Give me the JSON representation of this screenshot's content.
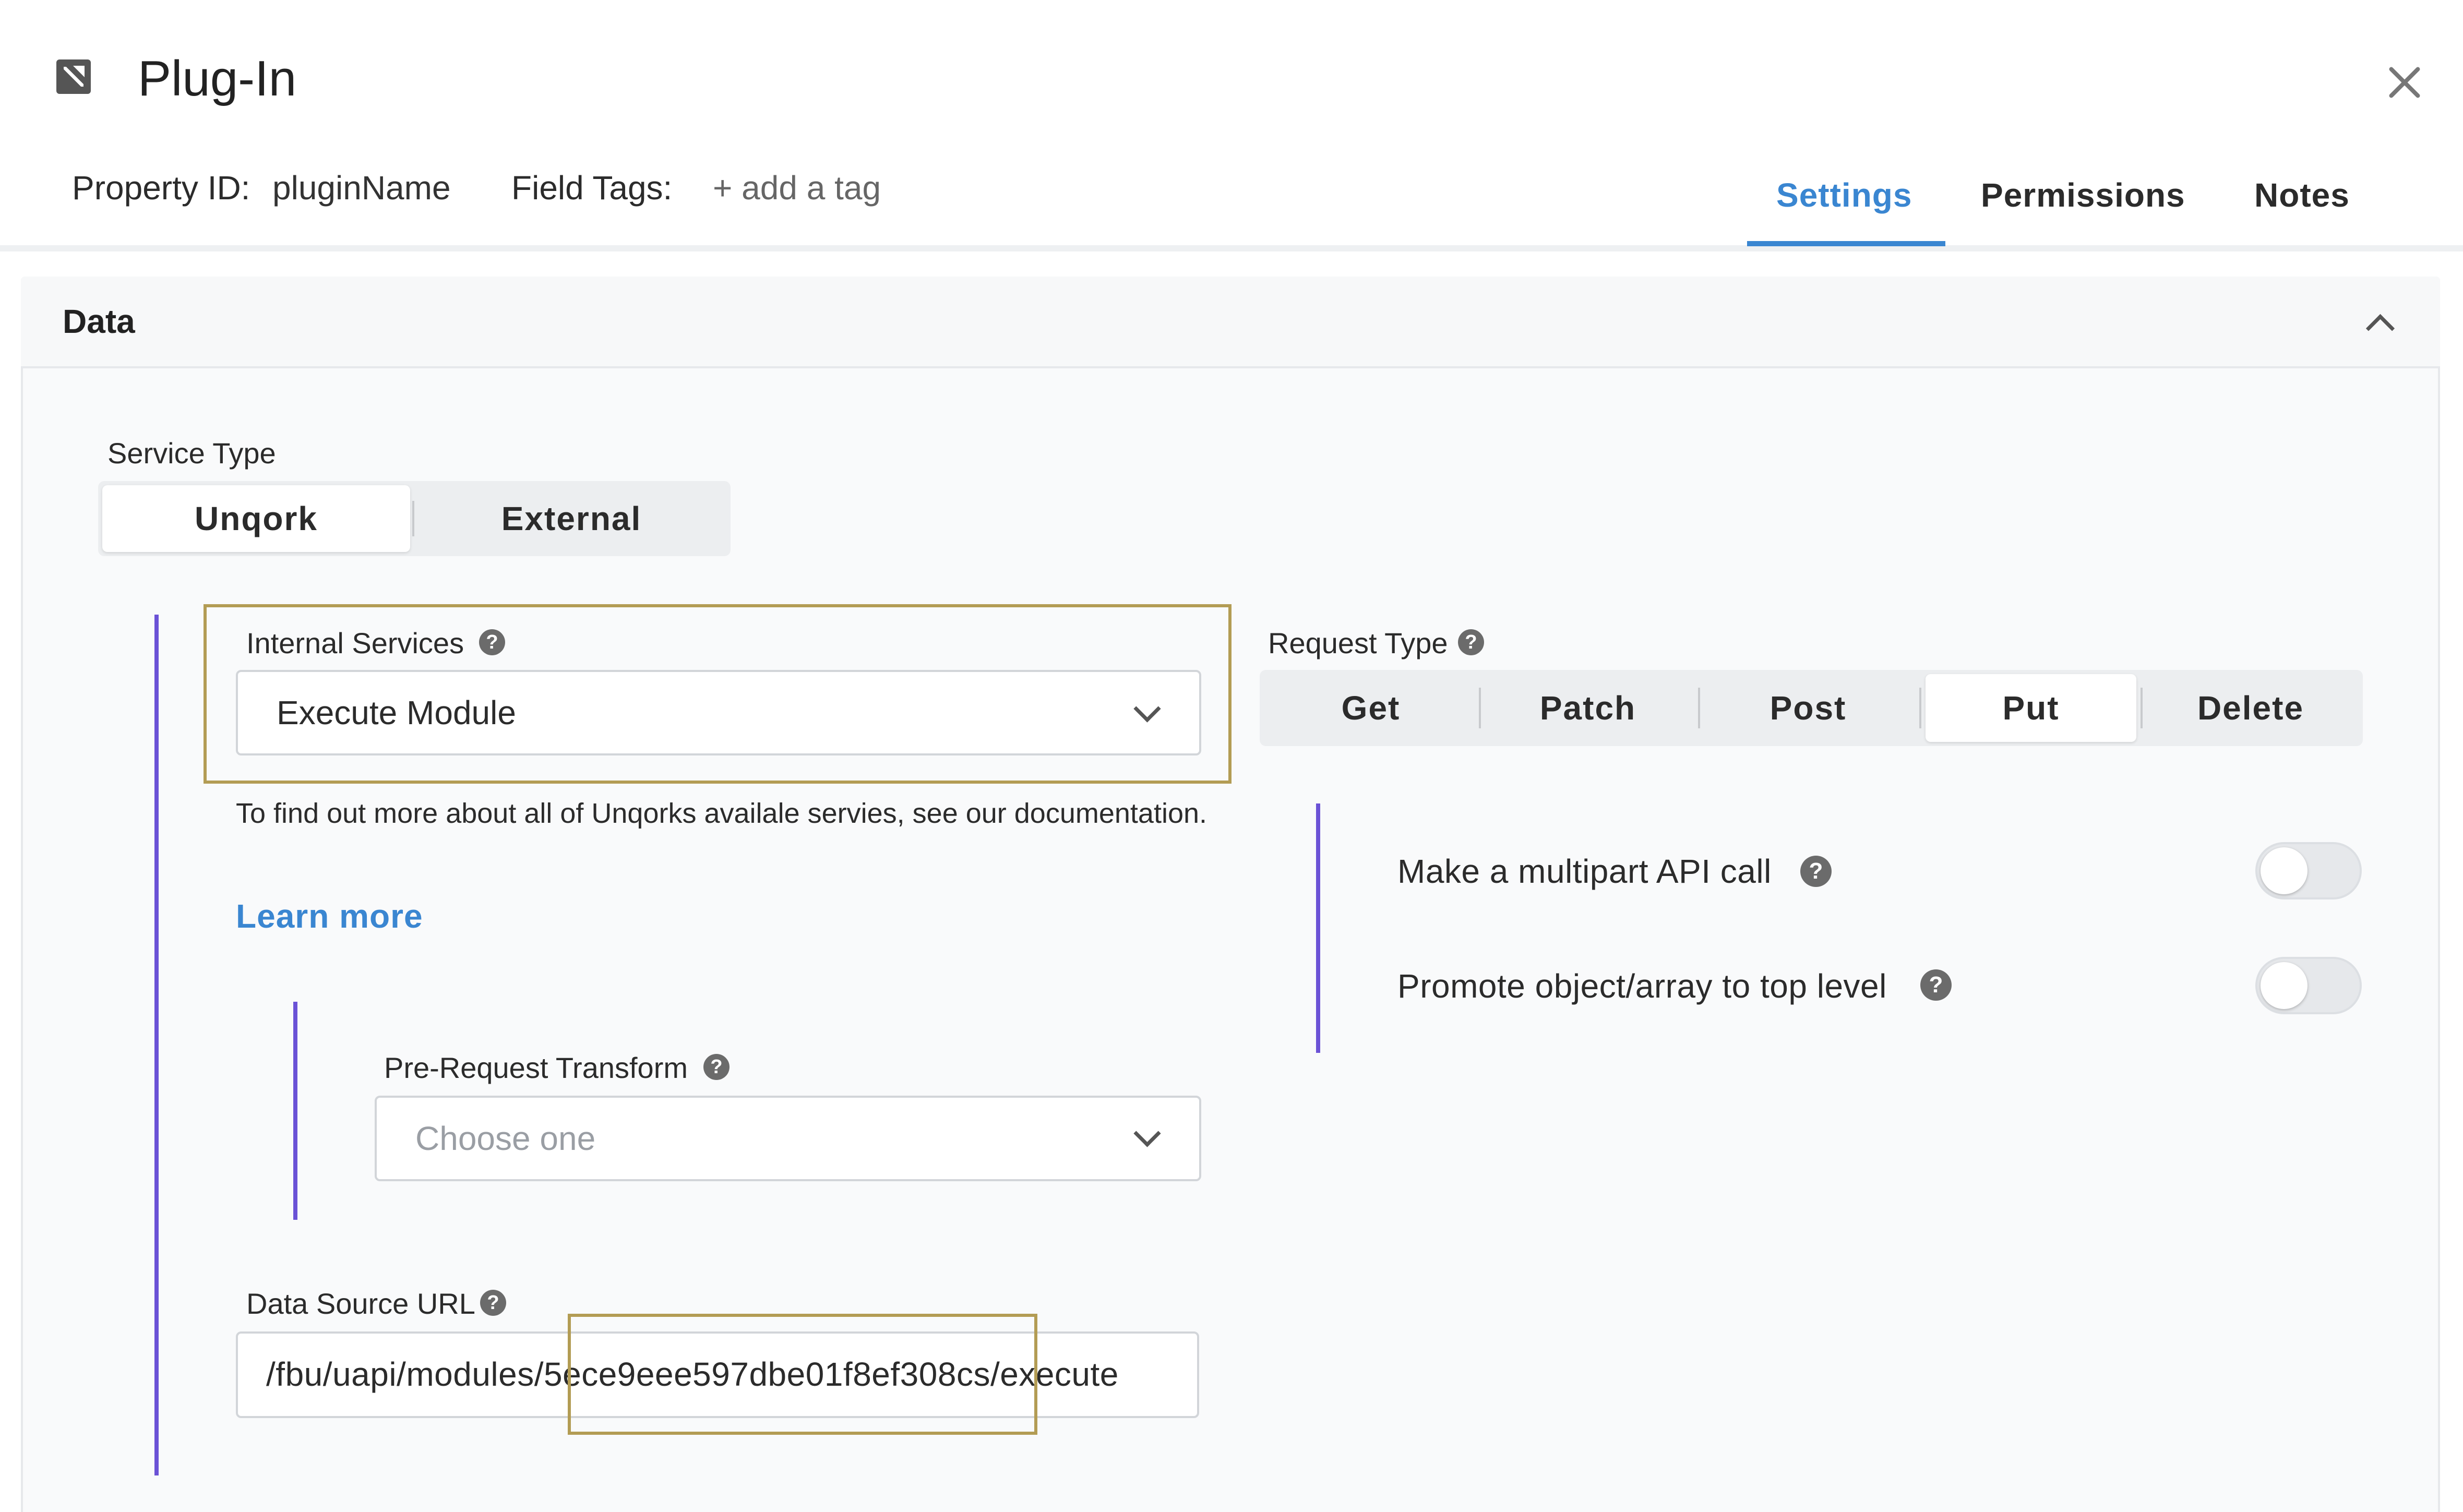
{
  "header": {
    "title": "Plug-In",
    "property_id_label": "Property ID:",
    "property_id_value": "pluginName",
    "field_tags_label": "Field Tags:",
    "add_tag_label": "+ add a tag"
  },
  "tabs": {
    "settings": "Settings",
    "permissions": "Permissions",
    "notes": "Notes",
    "active": "settings"
  },
  "panel": {
    "title": "Data"
  },
  "service_type": {
    "label": "Service Type",
    "options": [
      "Unqork",
      "External"
    ],
    "selected": "Unqork"
  },
  "internal_services": {
    "label": "Internal Services",
    "value": "Execute Module",
    "help_text": "To find out more about all of Unqorks availale servies, see our documentation.",
    "learn_more": "Learn more"
  },
  "pre_request_transform": {
    "label": "Pre-Request Transform",
    "placeholder": "Choose one"
  },
  "data_source_url": {
    "label": "Data Source URL",
    "value": "/fbu/uapi/modules/5ece9eee597dbe01f8ef308cs/execute"
  },
  "request_type": {
    "label": "Request Type",
    "options": [
      "Get",
      "Patch",
      "Post",
      "Put",
      "Delete"
    ],
    "selected": "Put"
  },
  "options": {
    "multipart": {
      "label": "Make a multipart API call",
      "enabled": false
    },
    "promote": {
      "label": "Promote object/array to top level",
      "enabled": false
    }
  },
  "colors": {
    "accent": "#3a86d1",
    "highlight": "#b39c54",
    "bar": "#6b52d6"
  },
  "icons": {
    "help": "?"
  }
}
